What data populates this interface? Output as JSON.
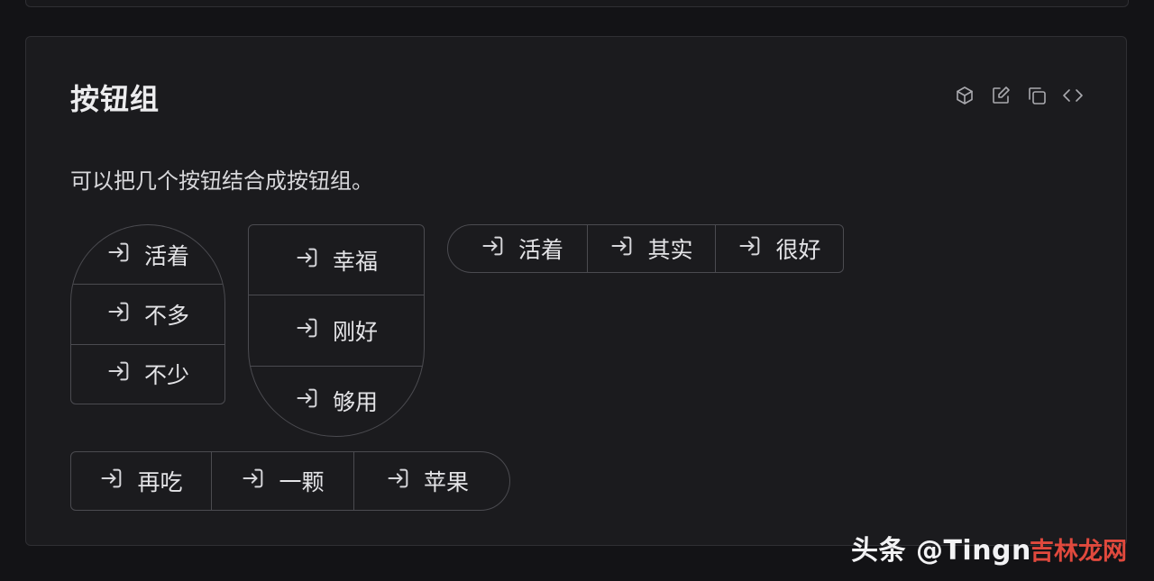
{
  "card": {
    "title": "按钮组",
    "description": "可以把几个按钮结合成按钮组。",
    "actions": [
      {
        "icon": "cube-icon"
      },
      {
        "icon": "edit-icon"
      },
      {
        "icon": "copy-icon"
      },
      {
        "icon": "code-icon"
      }
    ]
  },
  "groups": {
    "vertical_top_round": [
      "活着",
      "不多",
      "不少"
    ],
    "vertical_bottom_round": [
      "幸福",
      "刚好",
      "够用"
    ],
    "horizontal_left_round": [
      "活着",
      "其实",
      "很好"
    ],
    "horizontal_right_round": [
      "再吃",
      "一颗",
      "苹果"
    ]
  },
  "button_icon": "login-icon",
  "watermark": {
    "text": "头条 @Tingn",
    "overlay": "吉林龙网"
  },
  "colors": {
    "page_bg": "#131316",
    "card_bg": "#1b1b1e",
    "border": "#4b4b50",
    "text": "#e4e4e7"
  }
}
